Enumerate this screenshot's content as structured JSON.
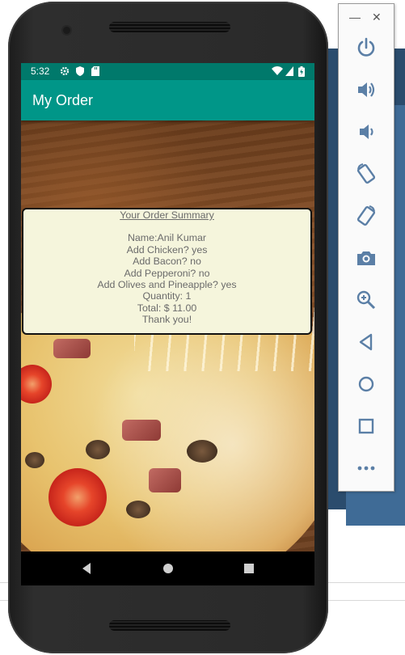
{
  "status_bar": {
    "time": "5:32",
    "battery_icon": "battery-charging-icon",
    "wifi_icon": "wifi-icon"
  },
  "app_bar": {
    "title": "My Order"
  },
  "order_summary": {
    "heading": "Your Order Summary",
    "lines": [
      "Name:Anil Kumar",
      "Add Chicken? yes",
      "Add Bacon? no",
      "Add Pepperoni? no",
      "Add Olives and Pineapple? yes",
      "Quantity: 1",
      "Total: $ 11.00",
      "Thank you!"
    ]
  },
  "nav_bar": {
    "back": "back-icon",
    "home": "home-icon",
    "recents": "recents-icon"
  },
  "emulator_toolbar": {
    "window_controls": {
      "minimize": "—",
      "close": "✕"
    },
    "buttons": [
      "power",
      "volume-up",
      "volume-down",
      "rotate-left",
      "rotate-right",
      "screenshot",
      "zoom",
      "back",
      "home",
      "overview",
      "more"
    ]
  },
  "colors": {
    "status_bar": "#00796b",
    "app_bar": "#009688",
    "summary_bg": "#f5f5dc",
    "summary_text": "#6b6b6b",
    "toolbar_icon": "#5b7fa6"
  }
}
